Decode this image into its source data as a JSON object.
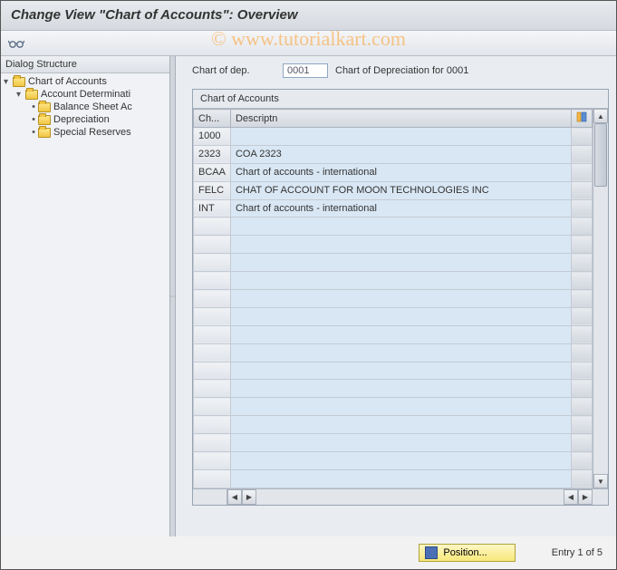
{
  "title": "Change View \"Chart of Accounts\": Overview",
  "watermark": "© www.tutorialkart.com",
  "sidebar": {
    "header": "Dialog Structure",
    "root": {
      "label": "Chart of Accounts",
      "children": [
        {
          "label": "Account Determinati",
          "children": [
            {
              "label": "Balance Sheet Ac"
            },
            {
              "label": "Depreciation"
            },
            {
              "label": "Special Reserves"
            }
          ]
        }
      ]
    }
  },
  "field": {
    "label": "Chart of dep.",
    "value": "0001",
    "desc": "Chart of Depreciation for 0001"
  },
  "table": {
    "title": "Chart of Accounts",
    "col1": "Ch...",
    "col2": "Descriptn",
    "rows": [
      {
        "code": "1000",
        "desc": ""
      },
      {
        "code": "2323",
        "desc": "COA 2323"
      },
      {
        "code": "BCAA",
        "desc": "Chart of accounts - international"
      },
      {
        "code": "FELC",
        "desc": "CHAT OF ACCOUNT FOR MOON TECHNOLOGIES INC"
      },
      {
        "code": "INT",
        "desc": "Chart of accounts - international"
      }
    ]
  },
  "footer": {
    "position_label": "Position...",
    "entry_text": "Entry 1 of 5"
  }
}
